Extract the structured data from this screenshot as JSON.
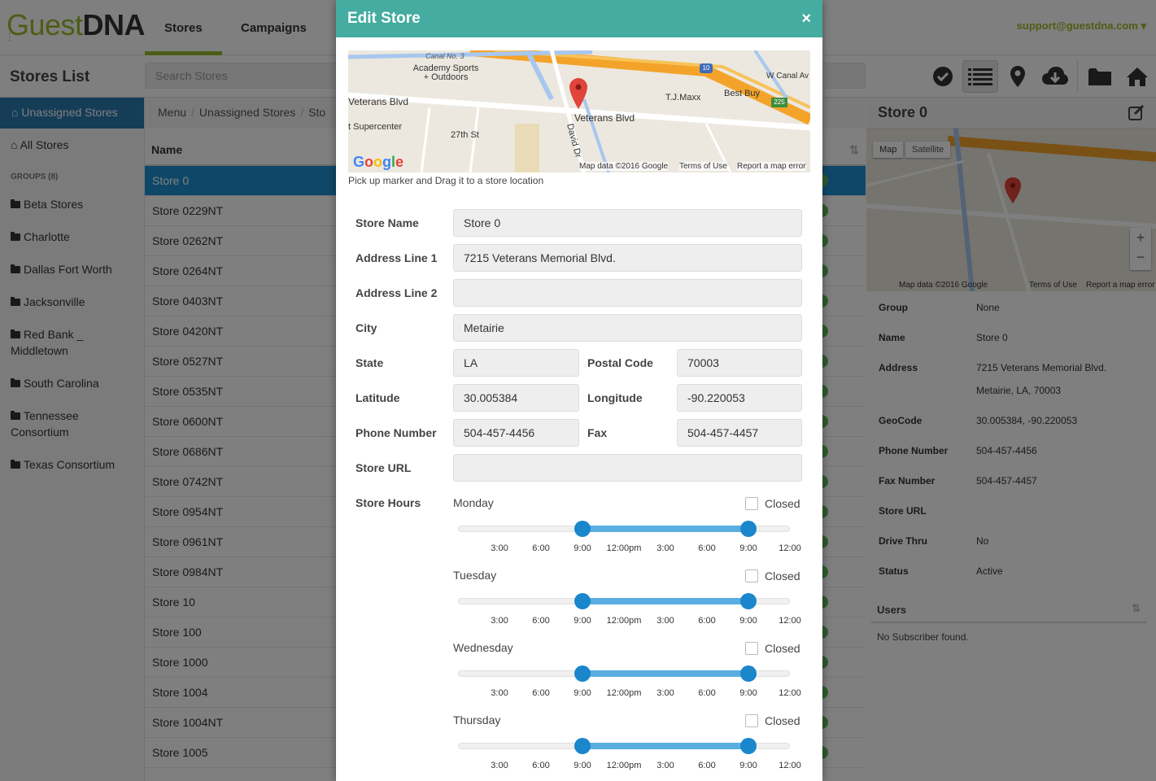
{
  "logo": {
    "part1": "Guest",
    "part2": "DNA"
  },
  "nav": {
    "tabs": [
      {
        "label": "Stores"
      },
      {
        "label": "Campaigns"
      }
    ],
    "user_email": "support@guestdna.com"
  },
  "subheader": {
    "title": "Stores List",
    "search_placeholder": "Search Stores"
  },
  "sidebar": {
    "active_item": "Unassigned Stores",
    "all_stores": "All Stores",
    "groups_title": "GROUPS (8)",
    "groups": [
      "Beta Stores",
      "Charlotte",
      "Dallas Fort Worth",
      "Jacksonville",
      "Red Bank _ Middletown",
      "South Carolina",
      "Tennessee Consortium",
      "Texas Consortium"
    ]
  },
  "breadcrumb": [
    "Menu",
    "Unassigned Stores",
    "Sto"
  ],
  "list": {
    "header": "Name",
    "rows": [
      "Store 0",
      "Store 0229NT",
      "Store 0262NT",
      "Store 0264NT",
      "Store 0403NT",
      "Store 0420NT",
      "Store 0527NT",
      "Store 0535NT",
      "Store 0600NT",
      "Store 0686NT",
      "Store 0742NT",
      "Store 0954NT",
      "Store 0961NT",
      "Store 0984NT",
      "Store 10",
      "Store 100",
      "Store 1000",
      "Store 1004",
      "Store 1004NT",
      "Store 1005"
    ]
  },
  "detail": {
    "title": "Store 0",
    "map": {
      "tab_map": "Map",
      "tab_satellite": "Satellite",
      "credit": "Map data ©2016 Google",
      "terms": "Terms of Use",
      "report": "Report a map error"
    },
    "fields": [
      {
        "label": "Group",
        "value": "None"
      },
      {
        "label": "Name",
        "value": "Store 0"
      },
      {
        "label": "Address",
        "value": "7215 Veterans Memorial Blvd.",
        "value2": "Metairie, LA, 70003"
      },
      {
        "label": "GeoCode",
        "value": "30.005384, -90.220053"
      },
      {
        "label": "Phone Number",
        "value": "504-457-4456"
      },
      {
        "label": "Fax Number",
        "value": "504-457-4457"
      },
      {
        "label": "Store URL",
        "value": ""
      },
      {
        "label": "Drive Thru",
        "value": "No"
      },
      {
        "label": "Status",
        "value": "Active"
      }
    ],
    "users_title": "Users",
    "users_empty": "No Subscriber found."
  },
  "modal": {
    "title": "Edit Store",
    "close": "×",
    "map": {
      "labels": {
        "canal": "Canal No. 3",
        "academy": "Academy Sports + Outdoors",
        "veterans1": "Veterans Blvd",
        "veterans2": "Veterans Blvd",
        "tjmaxx": "T.J.Maxx",
        "bestbuy": "Best Buy",
        "supercenter": "t Supercenter",
        "st27": "27th St",
        "david": "David Dr",
        "wcanal": "W Canal Av",
        "hw10": "10",
        "hw225": "225"
      },
      "credit": "Map data ©2016 Google",
      "terms": "Terms of Use",
      "report": "Report a map error"
    },
    "map_hint": "Pick up marker and Drag it to a store location",
    "form": {
      "store_name": {
        "label": "Store Name",
        "value": "Store 0"
      },
      "address1": {
        "label": "Address Line 1",
        "value": "7215 Veterans Memorial Blvd."
      },
      "address2": {
        "label": "Address Line 2",
        "value": ""
      },
      "city": {
        "label": "City",
        "value": "Metairie"
      },
      "state": {
        "label": "State",
        "value": "LA"
      },
      "postal": {
        "label": "Postal Code",
        "value": "70003"
      },
      "latitude": {
        "label": "Latitude",
        "value": "30.005384"
      },
      "longitude": {
        "label": "Longitude",
        "value": "-90.220053"
      },
      "phone": {
        "label": "Phone Number",
        "value": "504-457-4456"
      },
      "fax": {
        "label": "Fax",
        "value": "504-457-4457"
      },
      "url": {
        "label": "Store URL",
        "value": ""
      },
      "hours_label": "Store Hours",
      "closed_label": "Closed",
      "days": [
        {
          "day": "Monday",
          "open": 9,
          "close": 21
        },
        {
          "day": "Tuesday",
          "open": 9,
          "close": 21
        },
        {
          "day": "Wednesday",
          "open": 9,
          "close": 21
        },
        {
          "day": "Thursday",
          "open": 9,
          "close": 21
        }
      ],
      "ticks": [
        "3:00",
        "6:00",
        "9:00",
        "12:00pm",
        "3:00",
        "6:00",
        "9:00",
        "12:00"
      ]
    }
  },
  "colors": {
    "brand_green": "#9bbb2a",
    "modal_header": "#44aca0",
    "selected_row": "#1f8ed0",
    "slider": "#1a86cc"
  }
}
